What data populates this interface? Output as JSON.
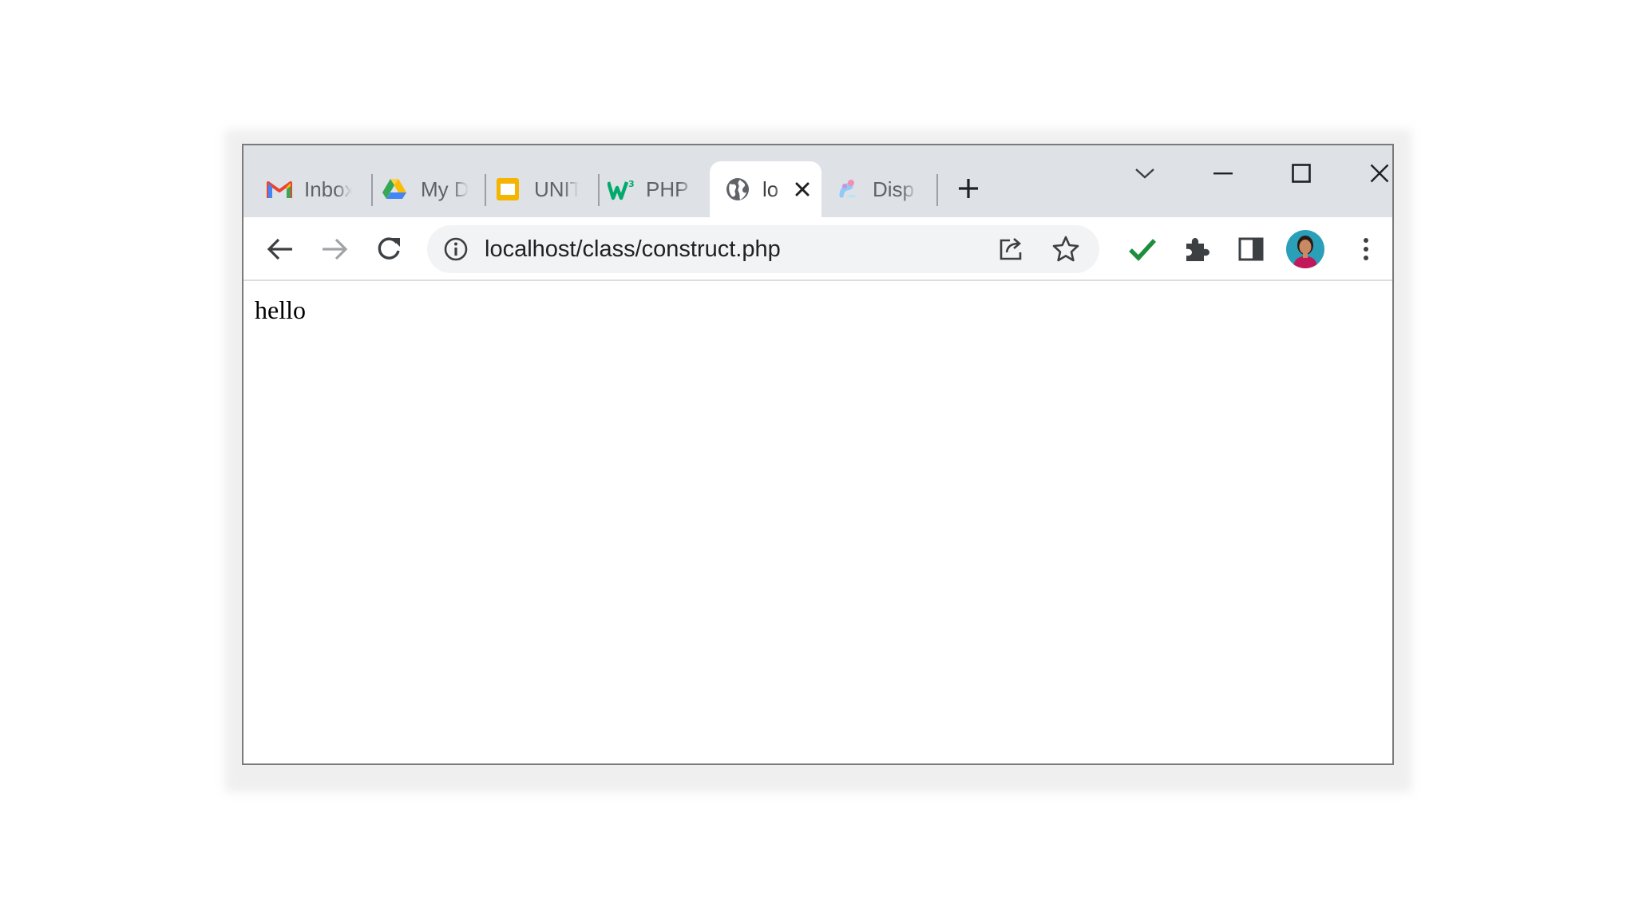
{
  "tabs": [
    {
      "label": "Inbox",
      "icon": "gmail-icon"
    },
    {
      "label": "My Drive",
      "icon": "google-drive-icon"
    },
    {
      "label": "UNIT",
      "icon": "google-slides-icon"
    },
    {
      "label": "PHP",
      "icon": "w3schools-icon"
    },
    {
      "label": "lo",
      "icon": "globe-icon",
      "active": true
    },
    {
      "label": "Disp",
      "icon": "photo-app-icon"
    }
  ],
  "address_bar": {
    "url": "localhost/class/construct.php"
  },
  "page": {
    "text": "hello"
  },
  "colors": {
    "tabstrip_bg": "#dee1e6",
    "active_tab_bg": "#ffffff",
    "omnibox_bg": "#f1f3f4",
    "extension_check": "#1e8e3e",
    "icon_gray": "#5f6368"
  }
}
